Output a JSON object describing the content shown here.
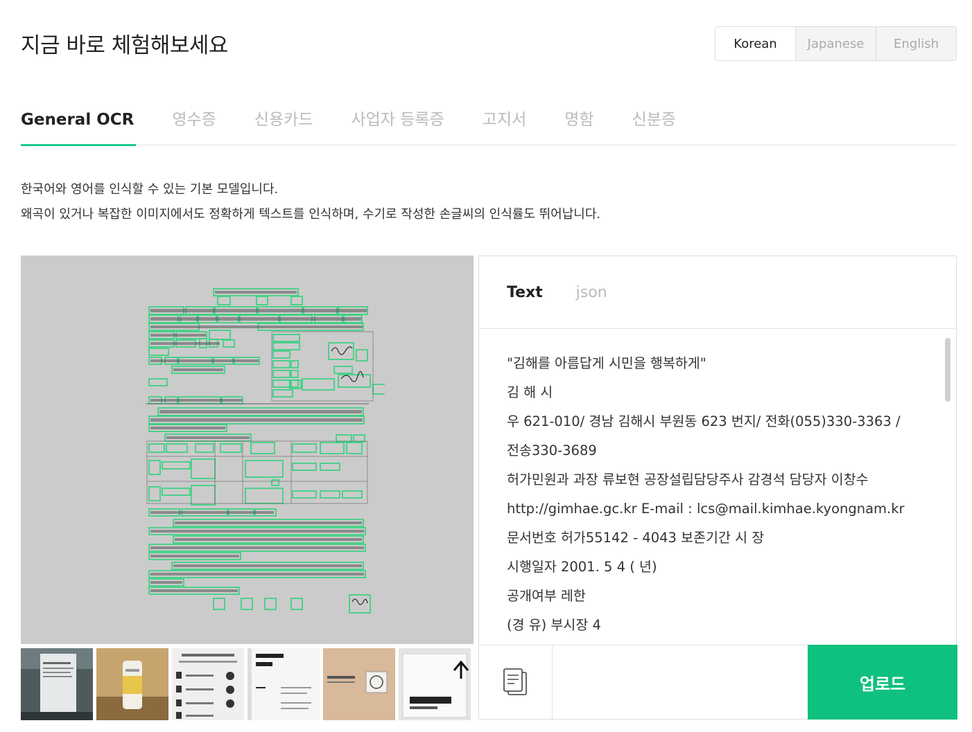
{
  "header": {
    "title": "지금 바로 체험해보세요"
  },
  "languages": [
    {
      "label": "Korean",
      "active": true
    },
    {
      "label": "Japanese",
      "active": false
    },
    {
      "label": "English",
      "active": false
    }
  ],
  "tabs": [
    {
      "label": "General OCR",
      "active": true
    },
    {
      "label": "영수증",
      "active": false
    },
    {
      "label": "신용카드",
      "active": false
    },
    {
      "label": "사업자 등록증",
      "active": false
    },
    {
      "label": "고지서",
      "active": false
    },
    {
      "label": "명함",
      "active": false
    },
    {
      "label": "신분증",
      "active": false
    }
  ],
  "description": {
    "line1": "한국어와 영어를 인식할 수 있는 기본 모델입니다.",
    "line2": "왜곡이 있거나 복잡한 이미지에서도 정확하게 텍스트를 인식하며, 수기로 작성한 손글씨의 인식률도 뛰어납니다."
  },
  "result": {
    "tabs": [
      {
        "label": "Text",
        "active": true
      },
      {
        "label": "json",
        "active": false
      }
    ],
    "lines": [
      "\"김해를 아름답게 시민을 행복하게\"",
      "김 해 시",
      "우 621-010/ 경남 김해시 부원동 623 번지/ 전화(055)330-3363 /",
      "전송330-3689",
      "허가민원과 과장 류보현 공장설립담당주사 감경석 담당자 이창수",
      "http://gimhae.gc.kr E-mail : lcs@mail.kimhae.kyongnam.kr",
      "문서번호 허가55142 - 4043 보존기간 시 장",
      "시행일자 2001. 5 4 ( 년)",
      "공개여부 레한",
      "(경 유) 부시장 4"
    ]
  },
  "actions": {
    "upload_label": "업로드"
  },
  "colors": {
    "accent": "#0fc17e",
    "tab_underline": "#1ec98a",
    "ocr_box": "#2fd27a"
  },
  "icons": {
    "copy": "copy-document-icon"
  }
}
